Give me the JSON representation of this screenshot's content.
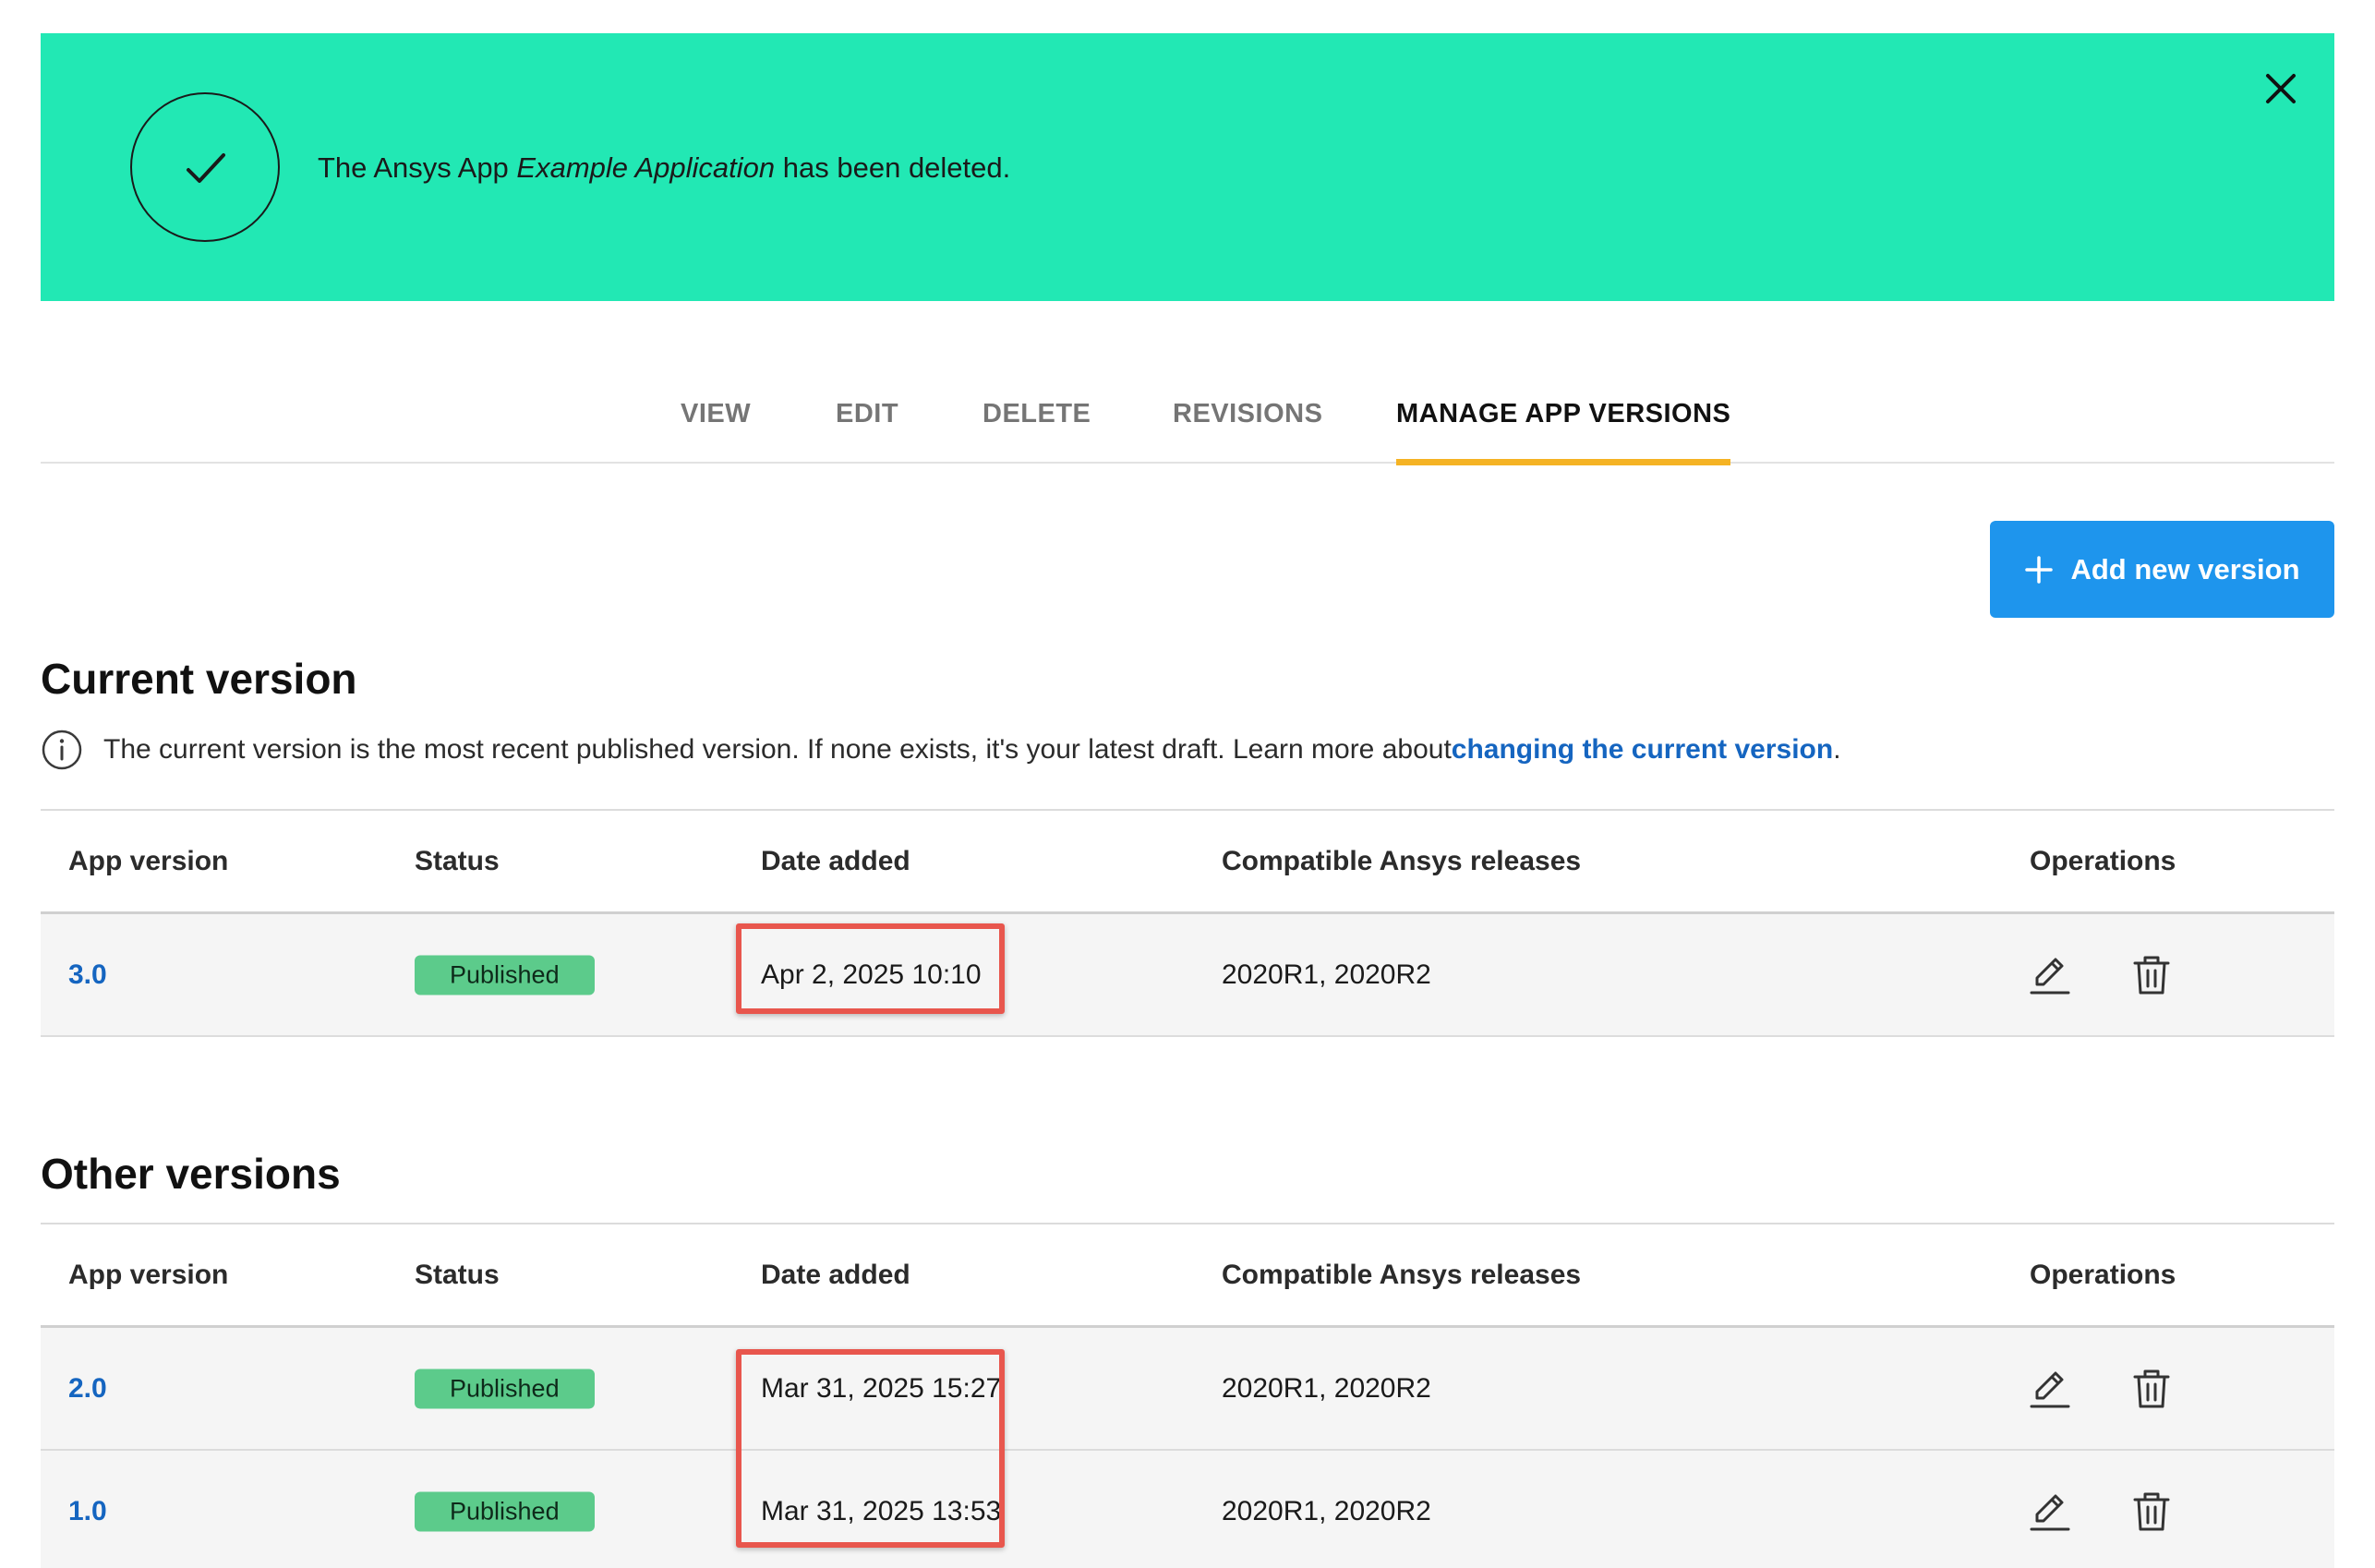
{
  "banner": {
    "message_prefix": "The Ansys App ",
    "message_app": "Example Application",
    "message_suffix": " has been deleted.",
    "bg_color": "#22e8b4"
  },
  "tabs": [
    {
      "label": "VIEW"
    },
    {
      "label": "EDIT"
    },
    {
      "label": "DELETE"
    },
    {
      "label": "REVISIONS"
    },
    {
      "label": "MANAGE APP VERSIONS",
      "active": true
    }
  ],
  "actions": {
    "add_label": "Add new version"
  },
  "current": {
    "title": "Current version",
    "info_text": "The current version is the most recent published version. If none exists, it's your latest draft. Learn more about ",
    "info_link": "changing the current version",
    "info_end": "."
  },
  "other": {
    "title": "Other versions"
  },
  "columns": {
    "version": "App version",
    "status": "Status",
    "date": "Date added",
    "compat": "Compatible Ansys releases",
    "ops": "Operations"
  },
  "current_rows": [
    {
      "version": "3.0",
      "status": "Published",
      "date": "Apr 2, 2025 10:10",
      "compat": "2020R1, 2020R2"
    }
  ],
  "other_rows": [
    {
      "version": "2.0",
      "status": "Published",
      "date": "Mar 31, 2025 15:27",
      "compat": "2020R1, 2020R2"
    },
    {
      "version": "1.0",
      "status": "Published",
      "date": "Mar 31, 2025 13:53",
      "compat": "2020R1, 2020R2"
    }
  ],
  "colors": {
    "accent": "#1e95ed",
    "link": "#1565c0",
    "tab_underline": "#f5b324",
    "badge": "#5ccb8b",
    "highlight": "#e8564d"
  }
}
